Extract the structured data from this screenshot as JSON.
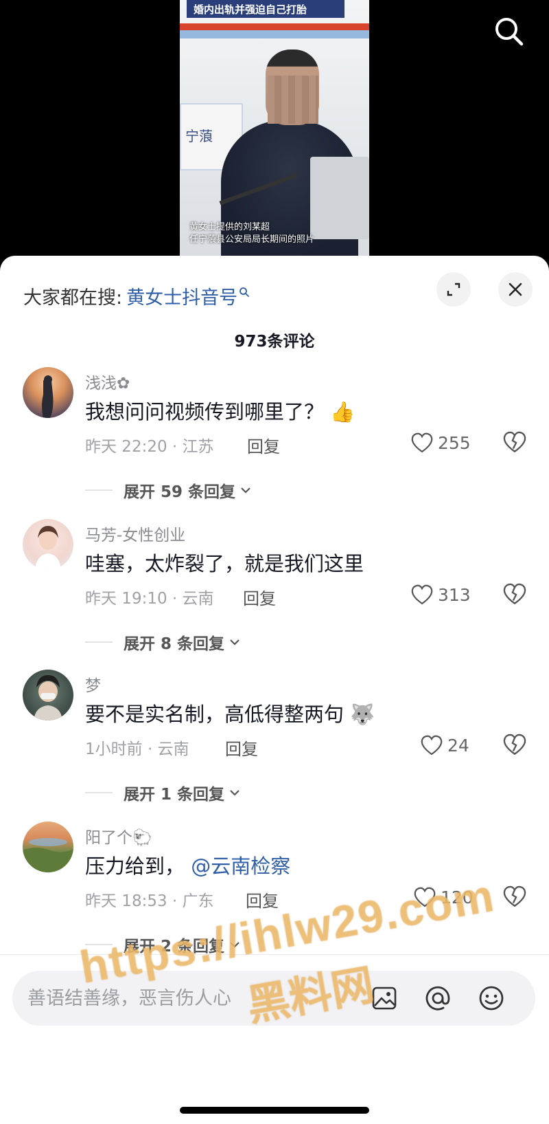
{
  "video": {
    "banner_text": "婚内出轨并强迫自己打胎",
    "sign_text": "宁蒗",
    "caption_line1": "黄女士提供的刘某超",
    "caption_line2": "任宁蒗县公安局局长期间的照片"
  },
  "sheet": {
    "suggest_prefix": "大家都在搜:",
    "suggest_term": "黄女士抖音号",
    "comment_count": "973条评论"
  },
  "comments": [
    {
      "name": "浅浅✿",
      "text": "我想问问视频传到哪里了？",
      "emoji": "👍",
      "time_location": "昨天 22:20 · 江苏",
      "reply": "回复",
      "likes": "255",
      "expand": "展开 59 条回复"
    },
    {
      "name": "马芳-女性创业",
      "text": "哇塞，太炸裂了，就是我们这里",
      "emoji": "",
      "time_location": "昨天 19:10 · 云南",
      "reply": "回复",
      "likes": "313",
      "expand": "展开 8 条回复"
    },
    {
      "name": "梦",
      "text": "要不是实名制，高低得整两句",
      "emoji": "🐺",
      "time_location": "1小时前 · 云南",
      "reply": "回复",
      "likes": "24",
      "expand": "展开 1 条回复"
    },
    {
      "name": "阳了个🐑",
      "text": "压力给到，",
      "mention": "@云南检察",
      "emoji": "",
      "time_location": "昨天 18:53 · 广东",
      "reply": "回复",
      "likes": "120",
      "expand": "展开 2 条回复"
    }
  ],
  "input": {
    "placeholder": "善语结善缘，恶言伤人心"
  },
  "watermark": {
    "url": "https://ihlw29.com",
    "brand": "黑料网"
  },
  "icons": {
    "top_search": "search-icon",
    "expand": "expand-icon",
    "close": "close-icon",
    "like": "heart-icon",
    "dislike": "broken-heart-icon",
    "image": "image-icon",
    "at": "at-icon",
    "emoji": "emoji-icon"
  },
  "colors": {
    "accent_blue": "#2f5fa8",
    "text_primary": "#161823",
    "text_secondary": "#8a8b91",
    "watermark": "#f0be6e"
  }
}
